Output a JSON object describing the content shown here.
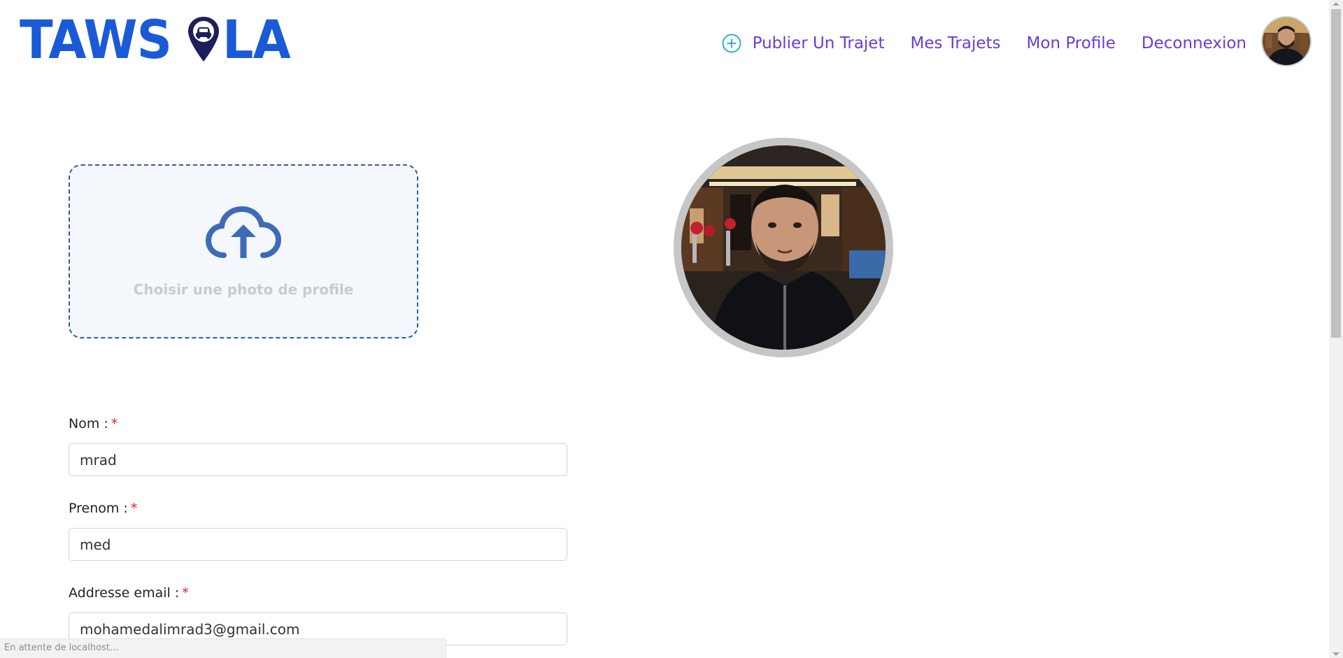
{
  "header": {
    "logo_part1": "TAWS",
    "logo_part2": "LA",
    "nav": {
      "publish": "Publier Un Trajet",
      "my_trips": "Mes Trajets",
      "my_profile": "Mon Profile",
      "logout": "Deconnexion"
    }
  },
  "upload": {
    "label": "Choisir une photo de profile"
  },
  "form": {
    "nom": {
      "label": "Nom :",
      "required_mark": "*",
      "value": "mrad"
    },
    "prenom": {
      "label": "Prenom :",
      "required_mark": "*",
      "value": "med"
    },
    "email": {
      "label": "Addresse email :",
      "required_mark": "*",
      "value": "mohamedalimrad3@gmail.com"
    }
  },
  "status_bar": {
    "text": "En attente de localhost..."
  },
  "colors": {
    "logo_blue": "#1a5ad8",
    "nav_purple": "#6a3bdb",
    "upload_border": "#2f5fa0",
    "upload_icon": "#3d6bb8",
    "required_red": "#e02020"
  },
  "icons": {
    "publish": "plus-circle-icon",
    "upload": "cloud-upload-icon",
    "logo_pin": "location-pin-car-icon"
  }
}
